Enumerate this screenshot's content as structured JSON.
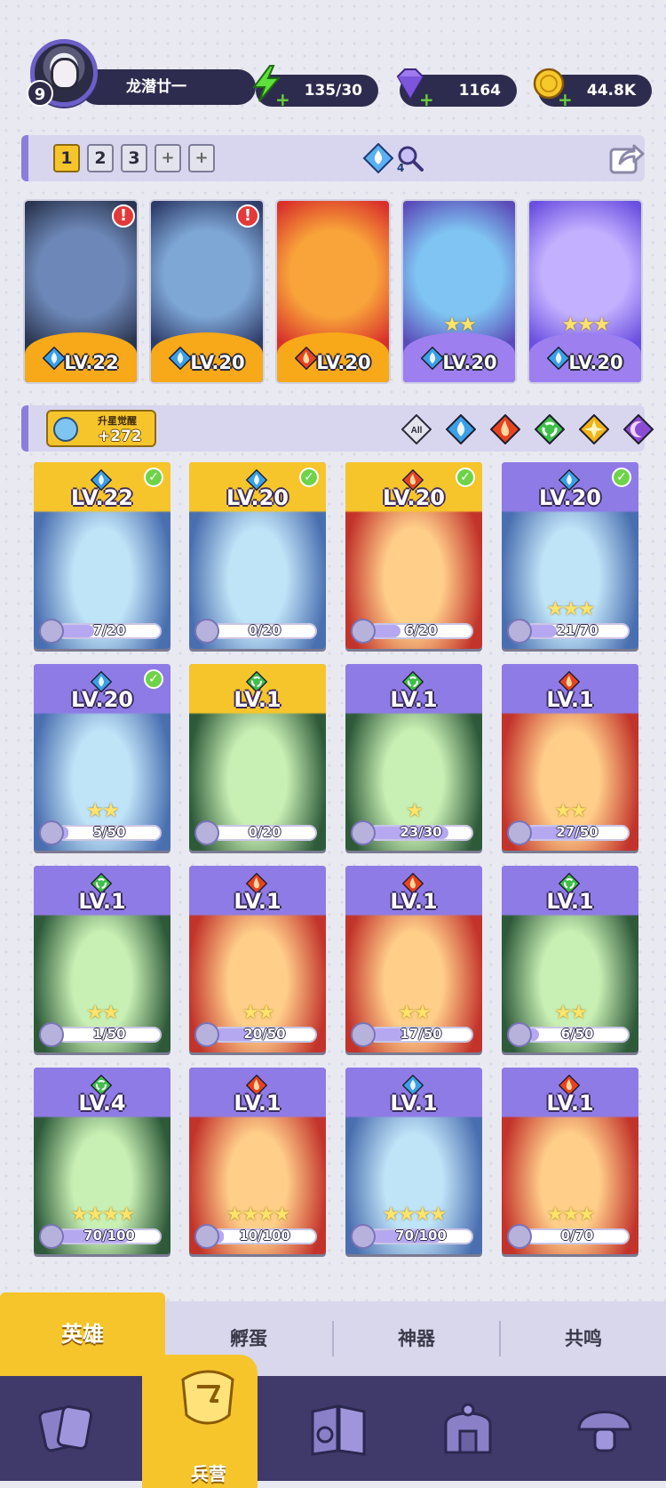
{
  "player": {
    "level": "9",
    "name": "龙潜廿一"
  },
  "resources": {
    "energy": "135/30",
    "gems": "1164",
    "gold": "44.8K"
  },
  "team": {
    "tabs": [
      "1",
      "2",
      "3",
      "+",
      "+"
    ],
    "active_tab": "1",
    "power_badge": "4",
    "slots": [
      {
        "level": "LV.22",
        "element": "water",
        "stars": 0,
        "alert": true
      },
      {
        "level": "LV.20",
        "element": "water",
        "stars": 0,
        "alert": true
      },
      {
        "level": "LV.20",
        "element": "fire",
        "stars": 0,
        "alert": false
      },
      {
        "level": "LV.20",
        "element": "water",
        "stars": 2,
        "alert": false
      },
      {
        "level": "LV.20",
        "element": "water",
        "stars": 3,
        "alert": false
      }
    ]
  },
  "filter": {
    "awaken_label": "升星觉醒",
    "awaken_value": "+272",
    "all_label": "All",
    "elements": [
      "water",
      "fire",
      "wind",
      "light",
      "dark"
    ]
  },
  "heroes": [
    {
      "level": "LV.22",
      "element": "water",
      "progress": "7/20",
      "stars": 0,
      "checked": true,
      "gold": true
    },
    {
      "level": "LV.20",
      "element": "water",
      "progress": "0/20",
      "stars": 0,
      "checked": true,
      "gold": true
    },
    {
      "level": "LV.20",
      "element": "fire",
      "progress": "6/20",
      "stars": 0,
      "checked": true,
      "gold": true
    },
    {
      "level": "LV.20",
      "element": "water",
      "progress": "21/70",
      "stars": 3,
      "checked": true,
      "gold": false
    },
    {
      "level": "LV.20",
      "element": "water",
      "progress": "5/50",
      "stars": 2,
      "checked": true,
      "gold": false
    },
    {
      "level": "LV.1",
      "element": "wind",
      "progress": "0/20",
      "stars": 0,
      "checked": false,
      "gold": true
    },
    {
      "level": "LV.1",
      "element": "wind",
      "progress": "23/30",
      "stars": 1,
      "checked": false,
      "gold": false
    },
    {
      "level": "LV.1",
      "element": "fire",
      "progress": "27/50",
      "stars": 2,
      "checked": false,
      "gold": false
    },
    {
      "level": "LV.1",
      "element": "wind",
      "progress": "1/50",
      "stars": 2,
      "checked": false,
      "gold": false
    },
    {
      "level": "LV.1",
      "element": "fire",
      "progress": "20/50",
      "stars": 2,
      "checked": false,
      "gold": false
    },
    {
      "level": "LV.1",
      "element": "fire",
      "progress": "17/50",
      "stars": 2,
      "checked": false,
      "gold": false
    },
    {
      "level": "LV.1",
      "element": "wind",
      "progress": "6/50",
      "stars": 2,
      "checked": false,
      "gold": false
    },
    {
      "level": "LV.4",
      "element": "wind",
      "progress": "70/100",
      "stars": 4,
      "checked": false,
      "gold": false
    },
    {
      "level": "LV.1",
      "element": "fire",
      "progress": "10/100",
      "stars": 4,
      "checked": false,
      "gold": false
    },
    {
      "level": "LV.1",
      "element": "water",
      "progress": "70/100",
      "stars": 4,
      "checked": false,
      "gold": false
    },
    {
      "level": "LV.1",
      "element": "fire",
      "progress": "0/70",
      "stars": 3,
      "checked": false,
      "gold": false
    }
  ],
  "subtabs": [
    "英雄",
    "孵蛋",
    "神器",
    "共鸣"
  ],
  "active_subtab": "英雄",
  "nav": {
    "active_label": "兵营",
    "items": [
      "cards-icon",
      "barracks-icon",
      "map-book-icon",
      "shrine-icon",
      "mushroom-icon"
    ]
  },
  "colors": {
    "water": "#3aa0e8",
    "fire": "#e8431f",
    "wind": "#3fbf4a",
    "light": "#f2b316",
    "dark": "#8c4bd6",
    "accent": "#f6c52b"
  }
}
